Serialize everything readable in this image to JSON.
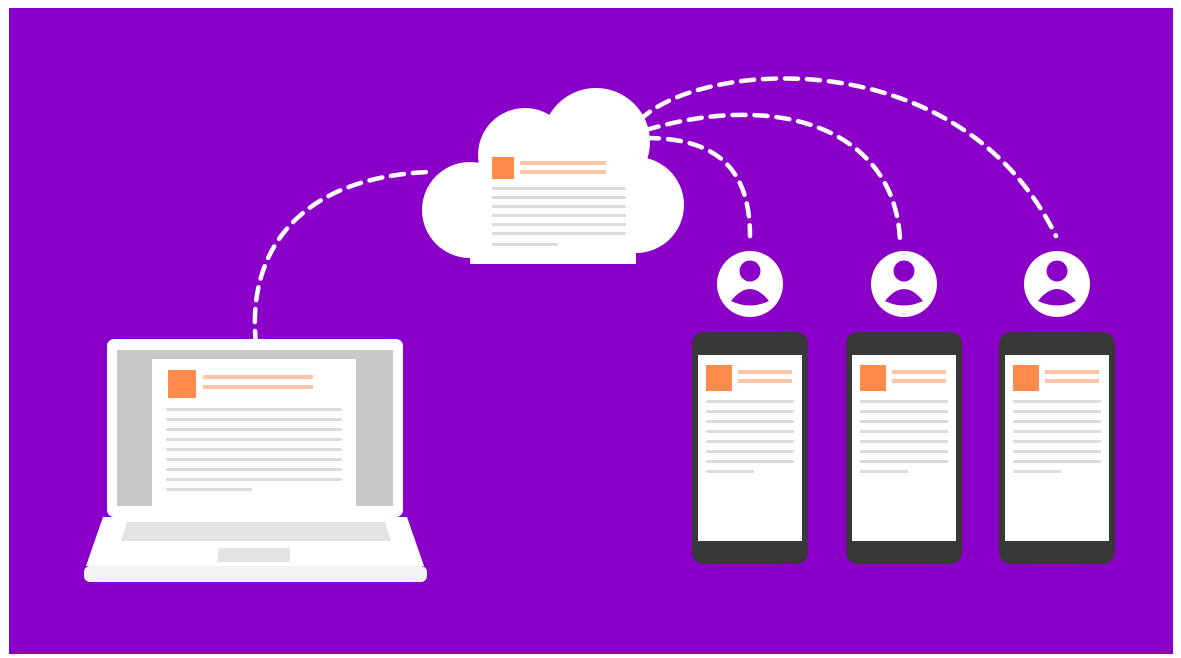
{
  "colors": {
    "background": "#8b00c8",
    "frame": "#ffffff",
    "device_white": "#ffffff",
    "laptop_bezel": "#c8c8c8",
    "laptop_base": "#f2f2f2",
    "phone_body": "#383838",
    "doc_accent": "#ff8a4c",
    "doc_accent_line": "#ffc4a4",
    "doc_line": "#dcdcdc",
    "connector": "#ffffff"
  },
  "icons": {
    "cloud": "cloud-icon",
    "user": "user-circle-icon",
    "laptop": "laptop-icon",
    "phone": "smartphone-icon",
    "document": "document-icon"
  },
  "diagram": {
    "source": "laptop",
    "hub": "cloud",
    "targets": [
      "phone-1",
      "phone-2",
      "phone-3"
    ],
    "connector_style": "dashed"
  }
}
